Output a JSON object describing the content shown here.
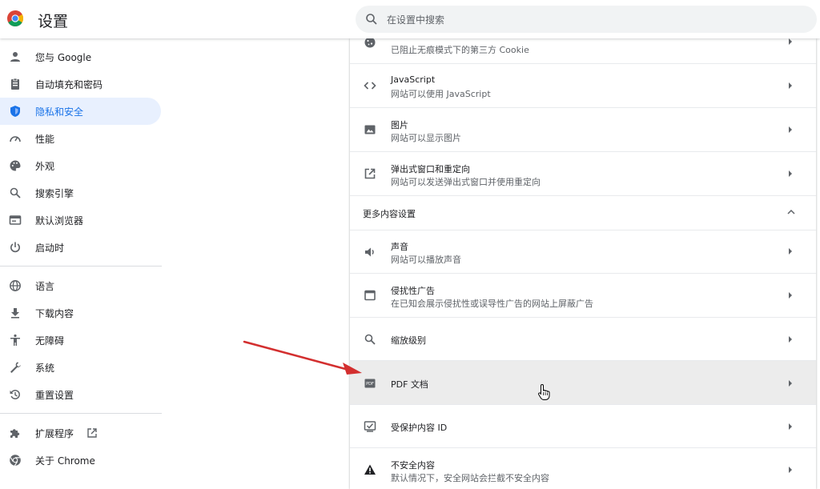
{
  "header": {
    "title": "设置",
    "search_placeholder": "在设置中搜索"
  },
  "sidebar": {
    "items": [
      {
        "label": "您与 Google",
        "icon": "person-icon"
      },
      {
        "label": "自动填充和密码",
        "icon": "clipboard-icon"
      },
      {
        "label": "隐私和安全",
        "icon": "shield-icon",
        "active": true
      },
      {
        "label": "性能",
        "icon": "speedometer-icon"
      },
      {
        "label": "外观",
        "icon": "palette-icon"
      },
      {
        "label": "搜索引擎",
        "icon": "search-icon"
      },
      {
        "label": "默认浏览器",
        "icon": "browser-icon"
      },
      {
        "label": "启动时",
        "icon": "power-icon"
      },
      {
        "label": "语言",
        "icon": "globe-icon"
      },
      {
        "label": "下载内容",
        "icon": "download-icon"
      },
      {
        "label": "无障碍",
        "icon": "accessibility-icon"
      },
      {
        "label": "系统",
        "icon": "wrench-icon"
      },
      {
        "label": "重置设置",
        "icon": "reset-icon"
      },
      {
        "label": "扩展程序",
        "icon": "puzzle-icon"
      },
      {
        "label": "关于 Chrome",
        "icon": "chrome-icon"
      }
    ]
  },
  "content": {
    "rows": [
      {
        "title": "",
        "subtitle": "已阻止无痕模式下的第三方 Cookie",
        "icon": "cookie-icon"
      },
      {
        "title": "JavaScript",
        "subtitle": "网站可以使用 JavaScript",
        "icon": "code-icon"
      },
      {
        "title": "图片",
        "subtitle": "网站可以显示图片",
        "icon": "image-icon"
      },
      {
        "title": "弹出式窗口和重定向",
        "subtitle": "网站可以发送弹出式窗口并使用重定向",
        "icon": "open-in-new-icon"
      }
    ],
    "more_section_title": "更多内容设置",
    "more_rows": [
      {
        "title": "声音",
        "subtitle": "网站可以播放声音",
        "icon": "volume-icon"
      },
      {
        "title": "侵扰性广告",
        "subtitle": "在已知会展示侵扰性或误导性广告的网站上屏蔽广告",
        "icon": "window-icon"
      },
      {
        "title": "缩放级别",
        "subtitle": "",
        "icon": "zoom-icon"
      },
      {
        "title": "PDF 文档",
        "subtitle": "",
        "icon": "pdf-icon",
        "hovered": true
      },
      {
        "title": "受保护内容 ID",
        "subtitle": "",
        "icon": "protected-content-icon"
      },
      {
        "title": "不安全内容",
        "subtitle": "默认情况下，安全网站会拦截不安全内容",
        "icon": "warning-icon"
      }
    ]
  },
  "colors": {
    "accent": "#1a73e8",
    "active_bg": "#e8f0fe",
    "annotation_arrow": "#d32f2f"
  }
}
